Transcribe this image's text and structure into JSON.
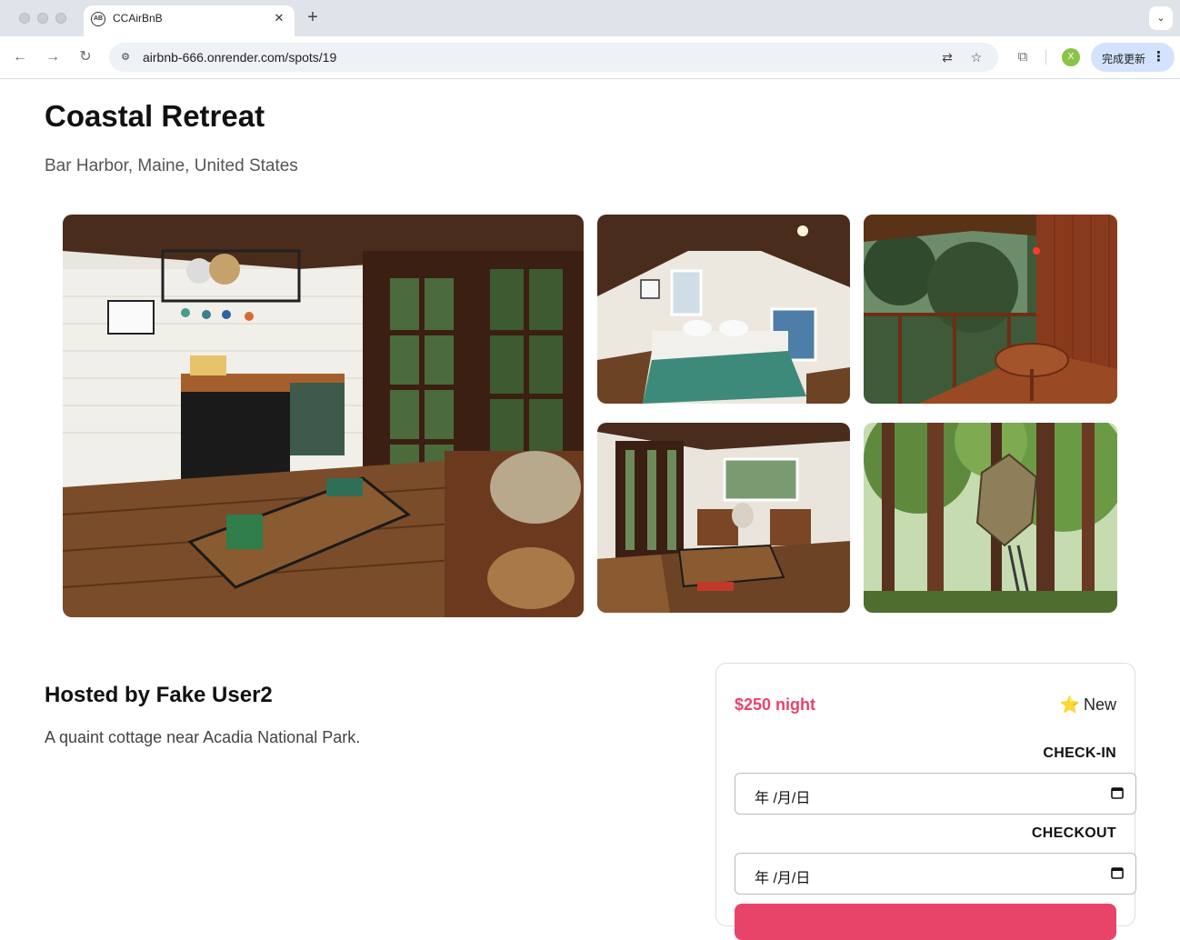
{
  "browser": {
    "tab_title": "CCAirBnB",
    "favicon_text": "AB",
    "url": "airbnb-666.onrender.com/spots/19",
    "profile_initial": "X",
    "update_label": "完成更新"
  },
  "spot": {
    "title": "Coastal Retreat",
    "location": "Bar Harbor, Maine, United States",
    "host_heading": "Hosted by Fake User2",
    "description": "A quaint cottage near Acadia National Park."
  },
  "booking": {
    "price": "$250 night",
    "rating": "New",
    "checkin_label": "CHECK-IN",
    "checkout_label": "CHECKOUT",
    "checkin_value": "年 /月/日",
    "checkout_value": "年 /月/日",
    "accent_color": "#e8446a"
  }
}
